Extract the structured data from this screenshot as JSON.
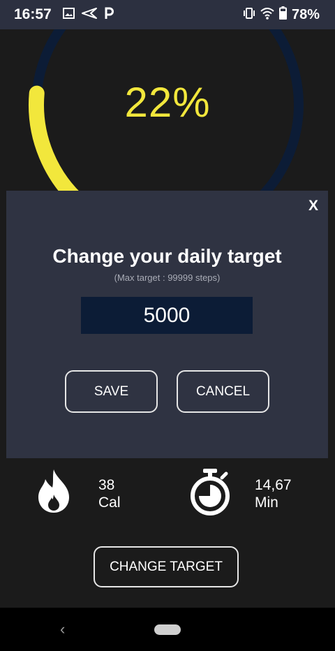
{
  "status_bar": {
    "time": "16:57",
    "battery": "78%",
    "left_icons": [
      "image-icon",
      "send-icon",
      "p-icon"
    ],
    "right_icons": [
      "vibrate-icon",
      "wifi-icon",
      "battery-icon"
    ]
  },
  "progress": {
    "percent_text": "22%",
    "fraction": 0.22,
    "ring_color": "#f2e73c",
    "track_color": "#0c1c36"
  },
  "dialog": {
    "close_label": "X",
    "title": "Change your daily target",
    "subtitle": "(Max target : 99999 steps)",
    "target_value": "5000",
    "save_label": "SAVE",
    "cancel_label": "CANCEL"
  },
  "stats": {
    "calories": {
      "value": "38",
      "unit": "Cal",
      "icon": "fire-icon"
    },
    "duration": {
      "value": "14,67",
      "unit": "Min",
      "icon": "stopwatch-icon"
    }
  },
  "change_target_label": "CHANGE TARGET",
  "nav": {
    "back": "‹"
  }
}
